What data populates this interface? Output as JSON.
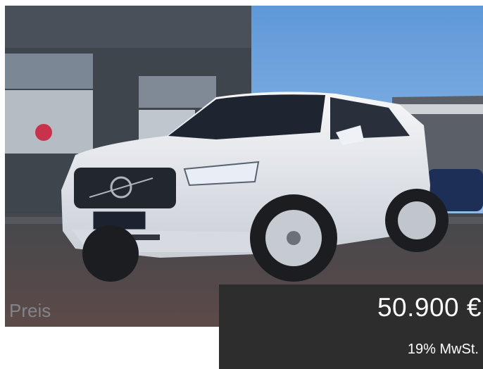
{
  "listing": {
    "photo_subject": "car-photo",
    "price_label": "Preis",
    "price_value": "50.900 €",
    "tax_note": "19% MwSt."
  },
  "colors": {
    "price_panel": "#2d2d2d",
    "price_text": "#ffffff",
    "label_text": "#8a8f95"
  }
}
